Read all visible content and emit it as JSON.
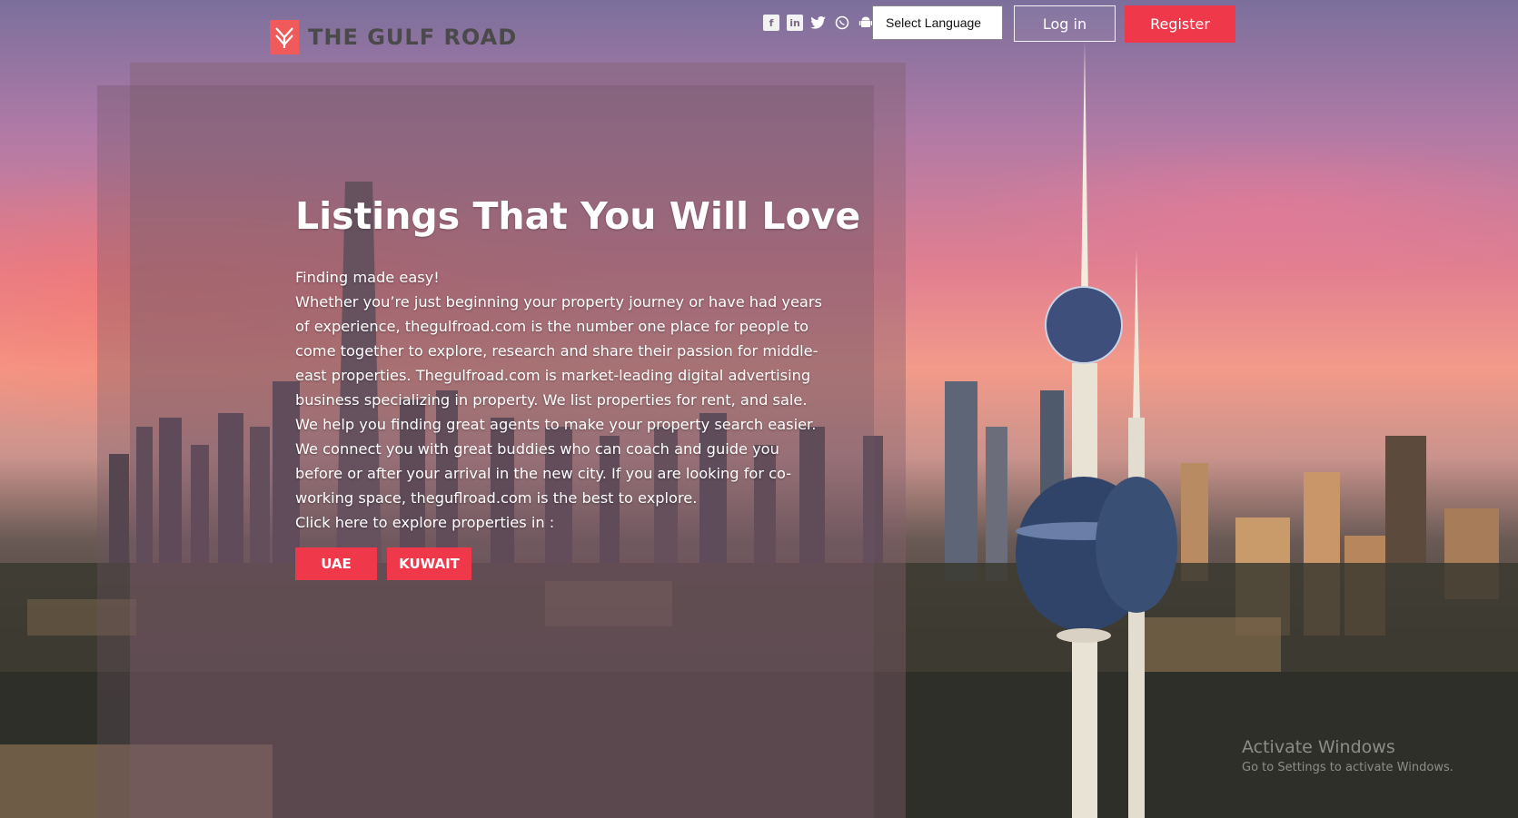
{
  "header": {
    "logo_text": "THE GULF ROAD",
    "socials": [
      {
        "name": "facebook-icon",
        "glyph": "f"
      },
      {
        "name": "linkedin-icon",
        "glyph": "in"
      },
      {
        "name": "twitter-icon",
        "glyph": "🐦"
      },
      {
        "name": "whatsapp-icon",
        "glyph": "✆"
      },
      {
        "name": "android-icon",
        "glyph": "⚙"
      }
    ],
    "language_select": "Select Language",
    "login_label": "Log in",
    "register_label": "Register"
  },
  "hero": {
    "headline": "Listings That You Will Love",
    "intro": "Finding made easy!",
    "body": "Whether you’re just beginning your property journey or have had years of experience, thegulfroad.com is the number one place for people to come together to explore, research and share their passion for middle-east properties. Thegulfroad.com is market-leading digital advertising business specializing in property. We list properties for rent, and sale. We help you finding great agents to make your property search easier. We connect you with great buddies who can coach and guide you before or after your arrival in the new city. If you are looking for co-working space, theguflroad.com is the best to explore.",
    "cta_prompt": "Click here to explore properties in :",
    "buttons": {
      "uae": "UAE",
      "kuwait": "KUWAIT"
    }
  },
  "watermark": {
    "line1": "Activate Windows",
    "line2": "Go to Settings to activate Windows."
  },
  "colors": {
    "accent": "#f0384b"
  }
}
